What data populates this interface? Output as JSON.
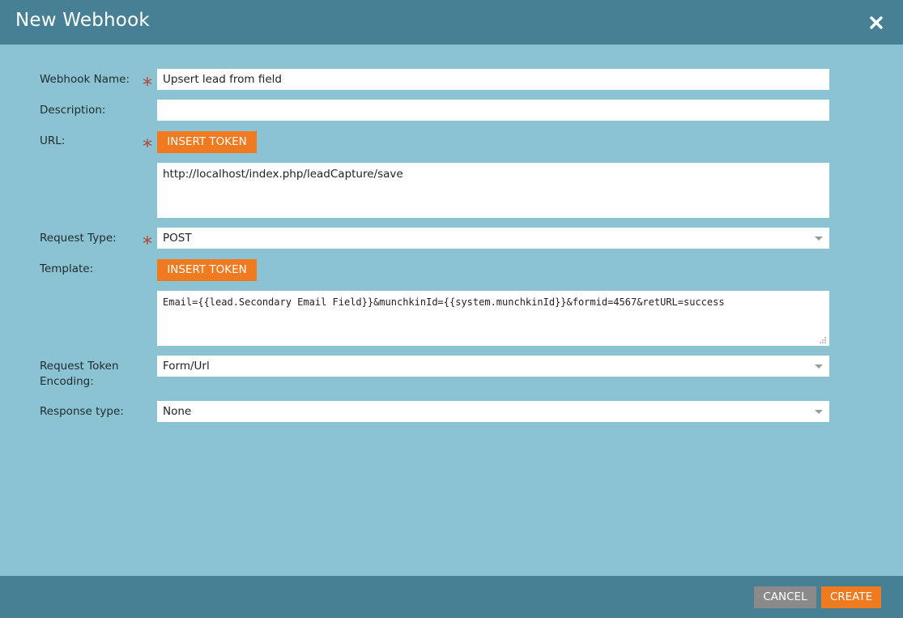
{
  "dialog": {
    "title": "New Webhook",
    "close_icon": "close-icon"
  },
  "form": {
    "webhook_name": {
      "label": "Webhook Name:",
      "required": true,
      "value": "Upsert lead from field"
    },
    "description": {
      "label": "Description:",
      "required": false,
      "value": ""
    },
    "url": {
      "label": "URL:",
      "required": true,
      "insert_token_label": "INSERT TOKEN",
      "value": "http://localhost/index.php/leadCapture/save"
    },
    "request_type": {
      "label": "Request Type:",
      "required": true,
      "value": "POST"
    },
    "template": {
      "label": "Template:",
      "insert_token_label": "INSERT TOKEN",
      "value": "Email={{lead.Secondary Email Field}}&munchkinId={{system.munchkinId}}&formid=4567&retURL=success"
    },
    "request_token_encoding": {
      "label_line1": "Request Token",
      "label_line2": "Encoding:",
      "value": "Form/Url"
    },
    "response_type": {
      "label": "Response type:",
      "value": "None"
    }
  },
  "required_marker": "*",
  "footer": {
    "cancel_label": "CANCEL",
    "create_label": "CREATE"
  },
  "colors": {
    "header": "#477f95",
    "body": "#8bc3d2",
    "accent": "#f07a20",
    "cancel": "#8a8a8a",
    "required": "#b5443a"
  }
}
